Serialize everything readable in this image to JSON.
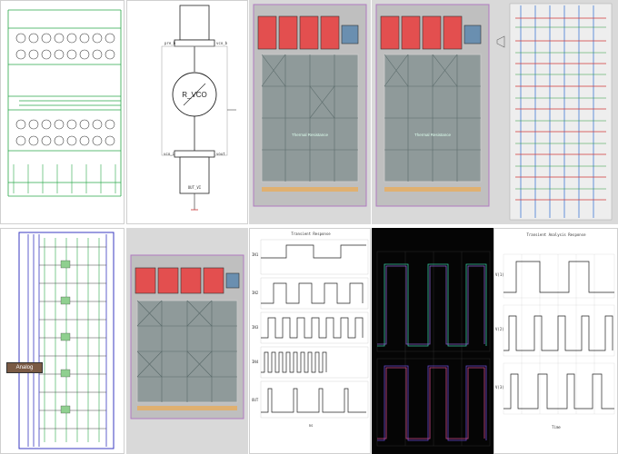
{
  "gallery": {
    "colors": {
      "background": "#ffffff",
      "tile_gray": "#d9d9d9",
      "layout_red": "#e34f4f",
      "wave_dark": "#050505"
    },
    "schematic_block": {
      "component_label": "R_VCO",
      "pin_top_left": "pre_b",
      "pin_top_right": "vco_b",
      "pin_bottom_left": "vco_i",
      "pin_bottom_right": "vout",
      "bottom_box_label": "OUT_VI"
    },
    "layout_caption": "Thermal Resistance",
    "multiplexer": {
      "analog_label": "Analog"
    },
    "waveform_light": {
      "title": "Transient Response",
      "time_unit": "ns",
      "trace_labels": [
        "IN1",
        "IN2",
        "IN3",
        "IN4",
        "OUT"
      ]
    },
    "waveform_dark": {
      "background": "#050505"
    },
    "waveform_sim": {
      "header": "Transient Analysis Response",
      "time_unit": "Time",
      "trace_labels": [
        "V(1)",
        "V(2)",
        "V(3)"
      ]
    }
  }
}
